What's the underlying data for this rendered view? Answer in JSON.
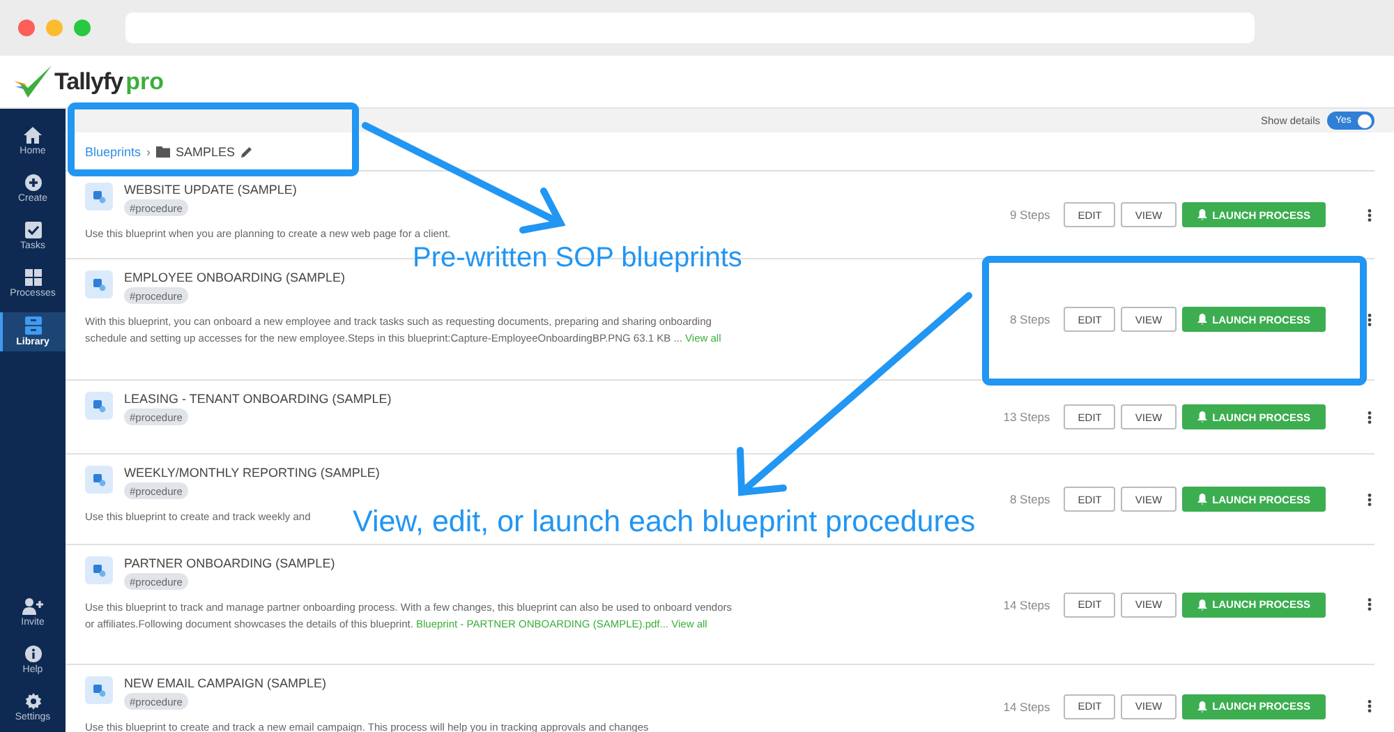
{
  "app": {
    "brand": "Tallyfy",
    "plan": "pro"
  },
  "sidebar": {
    "items": [
      {
        "label": "Home",
        "selected": false
      },
      {
        "label": "Create",
        "selected": false
      },
      {
        "label": "Tasks",
        "selected": false
      },
      {
        "label": "Processes",
        "selected": false
      },
      {
        "label": "Library",
        "selected": true
      }
    ],
    "bottom_items": [
      {
        "label": "Invite",
        "selected": false
      },
      {
        "label": "Help",
        "selected": false
      },
      {
        "label": "Settings",
        "selected": false
      }
    ]
  },
  "toolbar": {
    "show_details_label": "Show details",
    "show_details": {
      "on": true,
      "label": "Yes"
    }
  },
  "breadcrumb": {
    "root": "Blueprints",
    "separator": "›",
    "folder": "SAMPLES"
  },
  "blueprints": [
    {
      "title": "WEBSITE UPDATE (SAMPLE)",
      "tag": "#procedure",
      "description": [
        {
          "kind": "plain",
          "text": "Use this blueprint when you are planning to create a new web page for a client."
        }
      ],
      "steps": "9 Steps",
      "actions": {
        "edit": "EDIT",
        "view": "VIEW",
        "launch": "LAUNCH PROCESS"
      }
    },
    {
      "title": "EMPLOYEE ONBOARDING (SAMPLE)",
      "tag": "#procedure",
      "description": [
        {
          "kind": "plain",
          "text": "With this blueprint, you can onboard a new employee and track tasks such as requesting documents, preparing and sharing onboarding schedule and setting up accesses for the new employee.Steps in this blueprint:Capture-EmployeeOnboardingBP.PNG 63.1 KB ..."
        },
        {
          "kind": "link",
          "text": "View all"
        }
      ],
      "steps": "8 Steps",
      "actions": {
        "edit": "EDIT",
        "view": "VIEW",
        "launch": "LAUNCH PROCESS"
      }
    },
    {
      "title": "LEASING - TENANT ONBOARDING (SAMPLE)",
      "tag": "#procedure",
      "steps": "13 Steps",
      "actions": {
        "edit": "EDIT",
        "view": "VIEW",
        "launch": "LAUNCH PROCESS"
      }
    },
    {
      "title": "WEEKLY/MONTHLY REPORTING (SAMPLE)",
      "tag": "#procedure",
      "description": [
        {
          "kind": "plain",
          "text": "Use this blueprint to create and track weekly and"
        }
      ],
      "steps": "8 Steps",
      "actions": {
        "edit": "EDIT",
        "view": "VIEW",
        "launch": "LAUNCH PROCESS"
      }
    },
    {
      "title": "PARTNER ONBOARDING (SAMPLE)",
      "tag": "#procedure",
      "description": [
        {
          "kind": "plain",
          "text": "Use this blueprint to track and manage partner onboarding process. With a few changes, this blueprint can also be used to onboard vendors or affiliates.Following document showcases the details of this blueprint."
        },
        {
          "kind": "link",
          "text": "Blueprint - PARTNER ONBOARDING (SAMPLE).pdf..."
        },
        {
          "kind": "link",
          "text": "View all"
        }
      ],
      "steps": "14 Steps",
      "actions": {
        "edit": "EDIT",
        "view": "VIEW",
        "launch": "LAUNCH PROCESS"
      }
    },
    {
      "title": "NEW EMAIL CAMPAIGN (SAMPLE)",
      "tag": "#procedure",
      "description": [
        {
          "kind": "plain",
          "text": "Use this blueprint to create and track a new email campaign. This process will help you in tracking approvals and changes"
        }
      ],
      "steps": "14 Steps",
      "actions": {
        "edit": "EDIT",
        "view": "VIEW",
        "launch": "LAUNCH PROCESS"
      }
    }
  ],
  "callouts": [
    "Pre-written SOP blueprints",
    "View, edit, or launch each blueprint procedures"
  ]
}
